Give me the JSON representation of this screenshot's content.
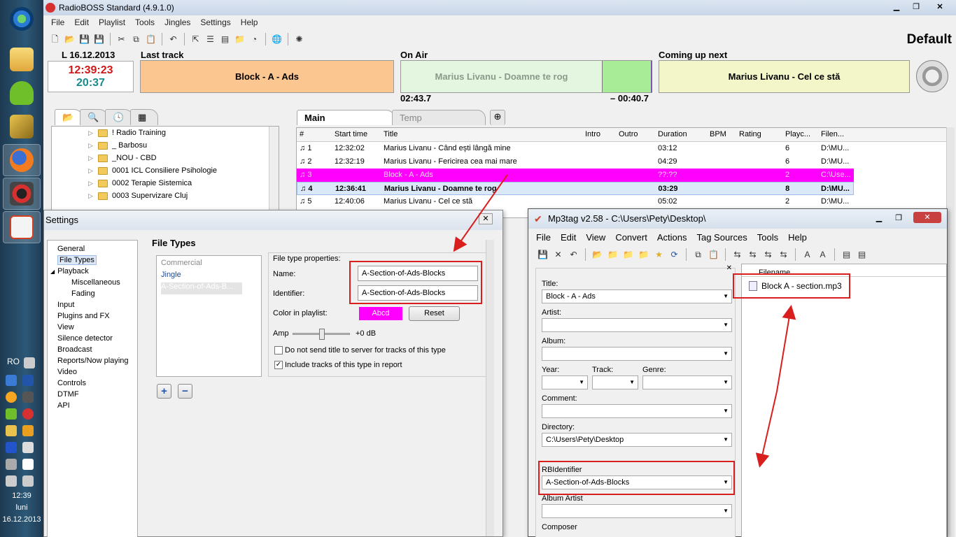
{
  "taskbar": {
    "tray_lang": "RO",
    "clock_time": "12:39",
    "clock_day": "luni",
    "clock_date": "16.12.2013"
  },
  "radioboss": {
    "title": "RadioBOSS Standard (4.9.1.0)",
    "menu": [
      "File",
      "Edit",
      "Playlist",
      "Tools",
      "Jingles",
      "Settings",
      "Help"
    ],
    "profile": "Default",
    "date": "L 16.12.2013",
    "clock_now": "12:39:23",
    "clock_remaining": "20:37",
    "last_track_label": "Last track",
    "last_track": "Block - A - Ads",
    "on_air_label": "On Air",
    "on_air": "Marius Livanu - Doamne te rog",
    "elapsed": "02:43.7",
    "remaining": "– 00:40.7",
    "coming_up_label": "Coming up next",
    "coming_up": "Marius Livanu - Cel ce stă",
    "tree_items": [
      "! Radio Training",
      "_ Barbosu",
      "_NOU - CBD",
      "0001 ICL Consiliere Psihologie",
      "0002 Terapie Sistemica",
      "0003 Supervizare Cluj"
    ],
    "tabs": [
      "Main",
      "Temp"
    ],
    "columns": [
      "#",
      "Start time",
      "Title",
      "Intro",
      "Outro",
      "Duration",
      "BPM",
      "Rating",
      "Playc...",
      "Filen..."
    ],
    "rows": [
      {
        "n": "1",
        "start": "12:32:02",
        "title": "Marius Livanu - Când ești lângă mine",
        "dur": "03:12",
        "plays": "6",
        "file": "D:\\MU..."
      },
      {
        "n": "2",
        "start": "12:32:19",
        "title": "Marius Livanu - Fericirea cea mai mare",
        "dur": "04:29",
        "plays": "6",
        "file": "D:\\MU..."
      },
      {
        "n": "3",
        "start": "",
        "title": "Block - A - Ads",
        "dur": "??:??",
        "plays": "2",
        "file": "C:\\Use..."
      },
      {
        "n": "4",
        "start": "12:36:41",
        "title": "Marius Livanu - Doamne te rog",
        "dur": "03:29",
        "plays": "8",
        "file": "D:\\MU..."
      },
      {
        "n": "5",
        "start": "12:40:06",
        "title": "Marius Livanu - Cel ce stă",
        "dur": "05:02",
        "plays": "2",
        "file": "D:\\MU..."
      }
    ],
    "colors": {
      "last_track": "#fbc690",
      "on_air": "#e4f6e0",
      "coming_up": "#f2f6c8",
      "ads_row": "#ff00ff",
      "accent_red": "#d91e1e"
    }
  },
  "settings": {
    "title": "Settings",
    "tree": [
      {
        "label": "General",
        "sub": false
      },
      {
        "label": "File Types",
        "sub": false
      },
      {
        "label": "Playback",
        "sub": false
      },
      {
        "label": "Miscellaneous",
        "sub": true
      },
      {
        "label": "Fading",
        "sub": true
      },
      {
        "label": "Input",
        "sub": false
      },
      {
        "label": "Plugins and FX",
        "sub": false
      },
      {
        "label": "View",
        "sub": false
      },
      {
        "label": "Silence detector",
        "sub": false
      },
      {
        "label": "Broadcast",
        "sub": false
      },
      {
        "label": "Reports/Now playing",
        "sub": false
      },
      {
        "label": "Video",
        "sub": false
      },
      {
        "label": "Controls",
        "sub": false
      },
      {
        "label": "DTMF",
        "sub": false
      },
      {
        "label": "API",
        "sub": false
      }
    ],
    "section_title": "File Types",
    "types": [
      "Commercial",
      "Jingle",
      "A-Section-of-Ads-B..."
    ],
    "props_title": "File type properties:",
    "name_label": "Name:",
    "name_value": "A-Section-of-Ads-Blocks",
    "id_label": "Identifier:",
    "id_value": "A-Section-of-Ads-Blocks",
    "color_label": "Color in playlist:",
    "color_sample": "Abcd",
    "reset": "Reset",
    "amp_label": "Amp",
    "amp_value": "+0 dB",
    "amp_level": 0.5,
    "chk1": "Do not send title to server for tracks of this type",
    "chk2": "Include tracks of this type in report",
    "add": "+",
    "remove": "−"
  },
  "mp3tag": {
    "title": "Mp3tag v2.58  -  C:\\Users\\Pety\\Desktop\\",
    "menu": [
      "File",
      "Edit",
      "View",
      "Convert",
      "Actions",
      "Tag Sources",
      "Tools",
      "Help"
    ],
    "fields": {
      "title_label": "Title:",
      "title": "Block - A - Ads",
      "artist_label": "Artist:",
      "album_label": "Album:",
      "year_label": "Year:",
      "track_label": "Track:",
      "genre_label": "Genre:",
      "comment_label": "Comment:",
      "directory_label": "Directory:",
      "directory": "C:\\Users\\Pety\\Desktop",
      "rbid_label": "RBIdentifier",
      "rbid": "A-Section-of-Ads-Blocks",
      "album_artist_label": "Album Artist",
      "composer_label": "Composer"
    },
    "filename_col": "Filename",
    "file": "Block A - section.mp3"
  }
}
